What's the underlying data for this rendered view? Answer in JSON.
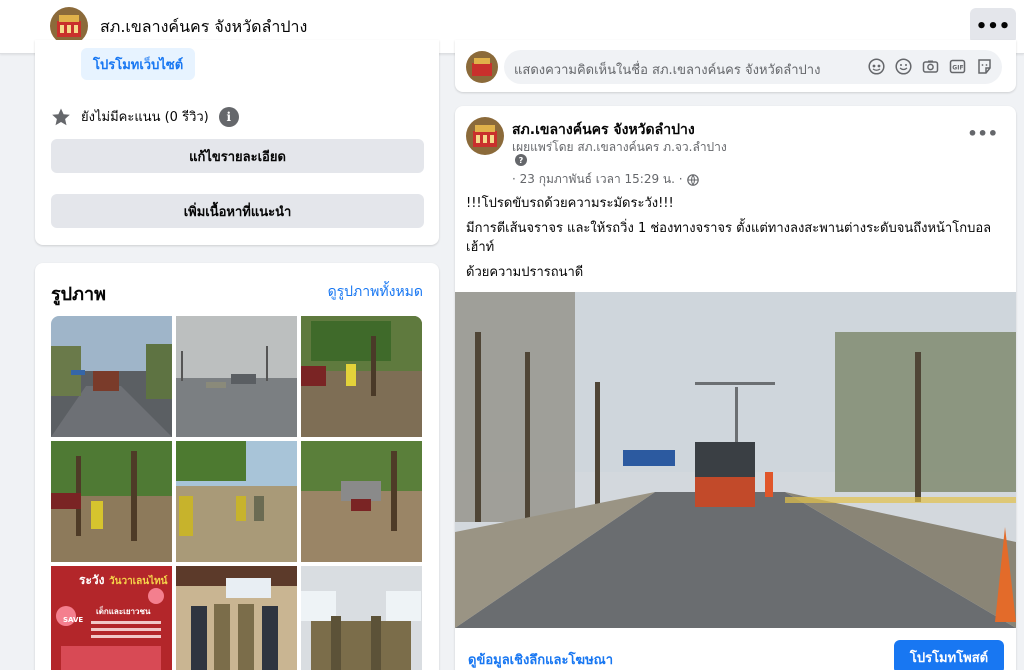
{
  "header": {
    "page_name": "สภ.เขลางค์นคร จังหวัดลำปาง",
    "more_icon": "more-horizontal-icon"
  },
  "about": {
    "promote_website": "โปรโมทเว็บไซต์",
    "rating_text": "ยังไม่มีคะแนน (0 รีวิว)",
    "edit_details": "แก้ไขรายละเอียด",
    "add_featured": "เพิ่มเนื้อหาที่แนะนำ"
  },
  "photos": {
    "title": "รูปภาพ",
    "see_all": "ดูรูปภาพทั้งหมด",
    "thumb3_text1": "ระวัง",
    "thumb3_text2": "วันวาเลนไทน์",
    "thumb3_text3": "SAVE",
    "thumb3_text4": "เด็กและเยาวชน"
  },
  "comment": {
    "placeholder": "แสดงความคิดเห็นในชื่อ สภ.เขลางค์นคร จังหวัดลำปาง",
    "icons": [
      "avatar-sticker-icon",
      "emoji-icon",
      "camera-icon",
      "gif-icon",
      "sticker-icon"
    ]
  },
  "post": {
    "author": "สภ.เขลางค์นคร จังหวัดลำปาง",
    "published_by": "เผยแพร่โดย สภ.เขลางค์นคร ภ.จว.ลำปาง",
    "date": "· 23 กุมภาพันธ์ เวลา 15:29 น. ·",
    "line1": "!!!โปรดขับรถด้วยความระมัดระวัง!!!",
    "line2": "มีการตีเส้นจราจร และให้รถวิ่ง 1 ช่องทางจราจร  ตั้งแต่ทางลงสะพานต่างระดับจนถึงหน้าโกบอลเฮ้าท์",
    "line3": "ด้วยความปรารถนาดี",
    "insights": "ดูข้อมูลเชิงลึกและโฆษณา",
    "boost": "โปรโมทโพสต์"
  }
}
